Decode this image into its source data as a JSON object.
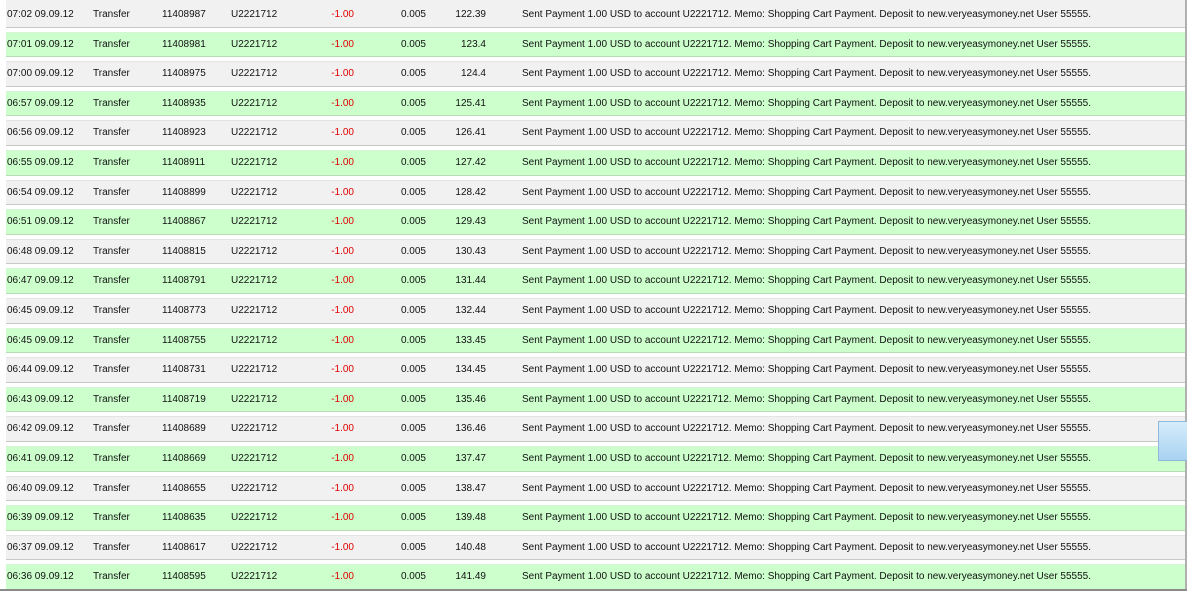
{
  "transactions": [
    {
      "date": "07:02 09.09.12",
      "type": "Transfer",
      "batch": "11408987",
      "account": "U2221712",
      "amount": "-1.00",
      "fee": "0.005",
      "balance": "122.39",
      "memo": "Sent Payment 1.00 USD to account U2221712. Memo: Shopping Cart Payment. Deposit to new.veryeasymoney.net User 55555."
    },
    {
      "date": "07:01 09.09.12",
      "type": "Transfer",
      "batch": "11408981",
      "account": "U2221712",
      "amount": "-1.00",
      "fee": "0.005",
      "balance": "123.4",
      "memo": "Sent Payment 1.00 USD to account U2221712. Memo: Shopping Cart Payment. Deposit to new.veryeasymoney.net User 55555."
    },
    {
      "date": "07:00 09.09.12",
      "type": "Transfer",
      "batch": "11408975",
      "account": "U2221712",
      "amount": "-1.00",
      "fee": "0.005",
      "balance": "124.4",
      "memo": "Sent Payment 1.00 USD to account U2221712. Memo: Shopping Cart Payment. Deposit to new.veryeasymoney.net User 55555."
    },
    {
      "date": "06:57 09.09.12",
      "type": "Transfer",
      "batch": "11408935",
      "account": "U2221712",
      "amount": "-1.00",
      "fee": "0.005",
      "balance": "125.41",
      "memo": "Sent Payment 1.00 USD to account U2221712. Memo: Shopping Cart Payment. Deposit to new.veryeasymoney.net User 55555."
    },
    {
      "date": "06:56 09.09.12",
      "type": "Transfer",
      "batch": "11408923",
      "account": "U2221712",
      "amount": "-1.00",
      "fee": "0.005",
      "balance": "126.41",
      "memo": "Sent Payment 1.00 USD to account U2221712. Memo: Shopping Cart Payment. Deposit to new.veryeasymoney.net User 55555."
    },
    {
      "date": "06:55 09.09.12",
      "type": "Transfer",
      "batch": "11408911",
      "account": "U2221712",
      "amount": "-1.00",
      "fee": "0.005",
      "balance": "127.42",
      "memo": "Sent Payment 1.00 USD to account U2221712. Memo: Shopping Cart Payment. Deposit to new.veryeasymoney.net User 55555."
    },
    {
      "date": "06:54 09.09.12",
      "type": "Transfer",
      "batch": "11408899",
      "account": "U2221712",
      "amount": "-1.00",
      "fee": "0.005",
      "balance": "128.42",
      "memo": "Sent Payment 1.00 USD to account U2221712. Memo: Shopping Cart Payment. Deposit to new.veryeasymoney.net User 55555."
    },
    {
      "date": "06:51 09.09.12",
      "type": "Transfer",
      "batch": "11408867",
      "account": "U2221712",
      "amount": "-1.00",
      "fee": "0.005",
      "balance": "129.43",
      "memo": "Sent Payment 1.00 USD to account U2221712. Memo: Shopping Cart Payment. Deposit to new.veryeasymoney.net User 55555."
    },
    {
      "date": "06:48 09.09.12",
      "type": "Transfer",
      "batch": "11408815",
      "account": "U2221712",
      "amount": "-1.00",
      "fee": "0.005",
      "balance": "130.43",
      "memo": "Sent Payment 1.00 USD to account U2221712. Memo: Shopping Cart Payment. Deposit to new.veryeasymoney.net User 55555."
    },
    {
      "date": "06:47 09.09.12",
      "type": "Transfer",
      "batch": "11408791",
      "account": "U2221712",
      "amount": "-1.00",
      "fee": "0.005",
      "balance": "131.44",
      "memo": "Sent Payment 1.00 USD to account U2221712. Memo: Shopping Cart Payment. Deposit to new.veryeasymoney.net User 55555."
    },
    {
      "date": "06:45 09.09.12",
      "type": "Transfer",
      "batch": "11408773",
      "account": "U2221712",
      "amount": "-1.00",
      "fee": "0.005",
      "balance": "132.44",
      "memo": "Sent Payment 1.00 USD to account U2221712. Memo: Shopping Cart Payment. Deposit to new.veryeasymoney.net User 55555."
    },
    {
      "date": "06:45 09.09.12",
      "type": "Transfer",
      "batch": "11408755",
      "account": "U2221712",
      "amount": "-1.00",
      "fee": "0.005",
      "balance": "133.45",
      "memo": "Sent Payment 1.00 USD to account U2221712. Memo: Shopping Cart Payment. Deposit to new.veryeasymoney.net User 55555."
    },
    {
      "date": "06:44 09.09.12",
      "type": "Transfer",
      "batch": "11408731",
      "account": "U2221712",
      "amount": "-1.00",
      "fee": "0.005",
      "balance": "134.45",
      "memo": "Sent Payment 1.00 USD to account U2221712. Memo: Shopping Cart Payment. Deposit to new.veryeasymoney.net User 55555."
    },
    {
      "date": "06:43 09.09.12",
      "type": "Transfer",
      "batch": "11408719",
      "account": "U2221712",
      "amount": "-1.00",
      "fee": "0.005",
      "balance": "135.46",
      "memo": "Sent Payment 1.00 USD to account U2221712. Memo: Shopping Cart Payment. Deposit to new.veryeasymoney.net User 55555."
    },
    {
      "date": "06:42 09.09.12",
      "type": "Transfer",
      "batch": "11408689",
      "account": "U2221712",
      "amount": "-1.00",
      "fee": "0.005",
      "balance": "136.46",
      "memo": "Sent Payment 1.00 USD to account U2221712. Memo: Shopping Cart Payment. Deposit to new.veryeasymoney.net User 55555."
    },
    {
      "date": "06:41 09.09.12",
      "type": "Transfer",
      "batch": "11408669",
      "account": "U2221712",
      "amount": "-1.00",
      "fee": "0.005",
      "balance": "137.47",
      "memo": "Sent Payment 1.00 USD to account U2221712. Memo: Shopping Cart Payment. Deposit to new.veryeasymoney.net User 55555."
    },
    {
      "date": "06:40 09.09.12",
      "type": "Transfer",
      "batch": "11408655",
      "account": "U2221712",
      "amount": "-1.00",
      "fee": "0.005",
      "balance": "138.47",
      "memo": "Sent Payment 1.00 USD to account U2221712. Memo: Shopping Cart Payment. Deposit to new.veryeasymoney.net User 55555."
    },
    {
      "date": "06:39 09.09.12",
      "type": "Transfer",
      "batch": "11408635",
      "account": "U2221712",
      "amount": "-1.00",
      "fee": "0.005",
      "balance": "139.48",
      "memo": "Sent Payment 1.00 USD to account U2221712. Memo: Shopping Cart Payment. Deposit to new.veryeasymoney.net User 55555."
    },
    {
      "date": "06:37 09.09.12",
      "type": "Transfer",
      "batch": "11408617",
      "account": "U2221712",
      "amount": "-1.00",
      "fee": "0.005",
      "balance": "140.48",
      "memo": "Sent Payment 1.00 USD to account U2221712. Memo: Shopping Cart Payment. Deposit to new.veryeasymoney.net User 55555."
    },
    {
      "date": "06:36 09.09.12",
      "type": "Transfer",
      "batch": "11408595",
      "account": "U2221712",
      "amount": "-1.00",
      "fee": "0.005",
      "balance": "141.49",
      "memo": "Sent Payment 1.00 USD to account U2221712. Memo: Shopping Cart Payment. Deposit to new.veryeasymoney.net User 55555."
    }
  ],
  "colors": {
    "row_odd": "#f1f1f1",
    "row_even": "#ccffcc",
    "amount_negative": "#e00000"
  }
}
